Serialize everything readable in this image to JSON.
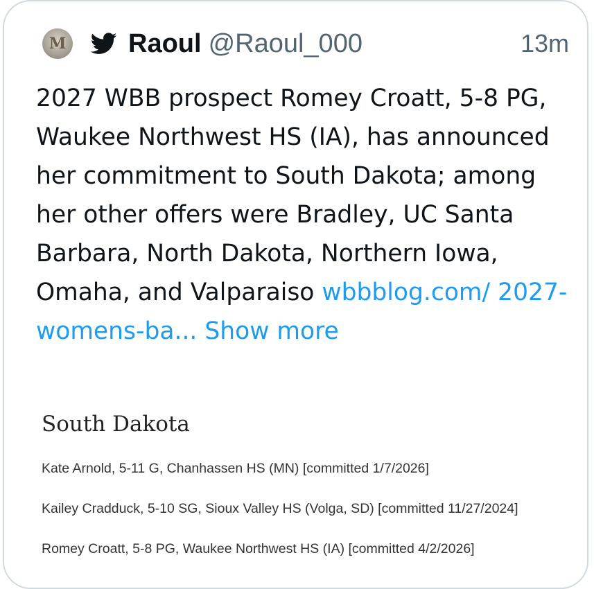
{
  "tweet": {
    "avatar_letter": "M",
    "icon": "twitter-bird-icon",
    "display_name": "Raoul",
    "handle": "@Raoul_000",
    "timestamp": "13m",
    "text": "2027 WBB prospect Romey Croatt, 5-8 PG, Waukee Northwest HS (IA), has announced her commitment to South Dakota; among her other offers were Bradley, UC Santa Barbara, North Dakota, Northern Iowa, Omaha, and Valparaiso ",
    "link_text": "wbbblog.com/ 2027-womens-ba...",
    "show_more": " Show more",
    "colors": {
      "link": "#1d9bf0",
      "text": "#0f1419",
      "muted": "#536471",
      "border": "#cfd9de"
    }
  },
  "clip": {
    "title": "South Dakota",
    "rows": [
      "Kate Arnold, 5-11 G, Chanhassen HS (MN) [committed 1/7/2026]",
      "Kailey Cradduck, 5-10 SG, Sioux Valley HS (Volga, SD) [committed 11/27/2024]",
      "Romey Croatt, 5-8 PG, Waukee Northwest HS (IA) [committed 4/2/2026]"
    ]
  }
}
